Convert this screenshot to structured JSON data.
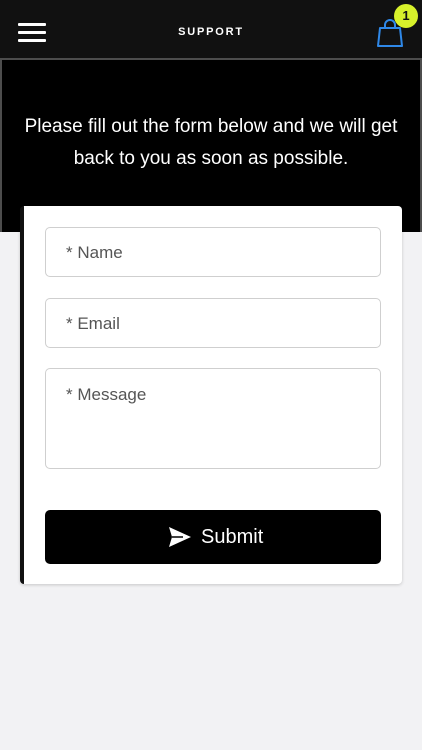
{
  "header": {
    "title": "SUPPORT",
    "menu_icon": "hamburger-menu-icon",
    "cart_icon": "shopping-bag-icon",
    "cart_count": "1",
    "badge_color": "#d7f12b"
  },
  "hero": {
    "message": "Please fill out the form below and we will get back to you as soon as possible."
  },
  "form": {
    "name_placeholder": "* Name",
    "email_placeholder": "* Email",
    "message_placeholder": "* Message",
    "submit_label": "Submit",
    "submit_icon": "send-icon"
  }
}
